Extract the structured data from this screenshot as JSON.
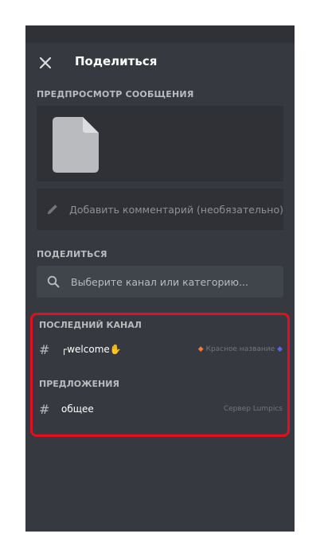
{
  "header": {
    "title": "Поделиться"
  },
  "preview": {
    "label": "ПРЕДПРОСМОТР СООБЩЕНИЯ"
  },
  "comment": {
    "placeholder": "Добавить комментарий (необязательно)"
  },
  "share": {
    "label": "ПОДЕЛИТЬСЯ",
    "search_placeholder": "Выберите канал или категорию..."
  },
  "recent": {
    "label": "ПОСЛЕДНИЙ КАНАЛ",
    "channel": {
      "name": "┌welcome✋",
      "server": "Красное название"
    }
  },
  "suggestions": {
    "label": "ПРЕДЛОЖЕНИЯ",
    "channel": {
      "name": "общее",
      "server": "Сервер Lumpics"
    }
  },
  "colors": {
    "background": "#36393f",
    "panel": "#2f3136",
    "input": "#40444b",
    "highlight_border": "#e0101e"
  }
}
